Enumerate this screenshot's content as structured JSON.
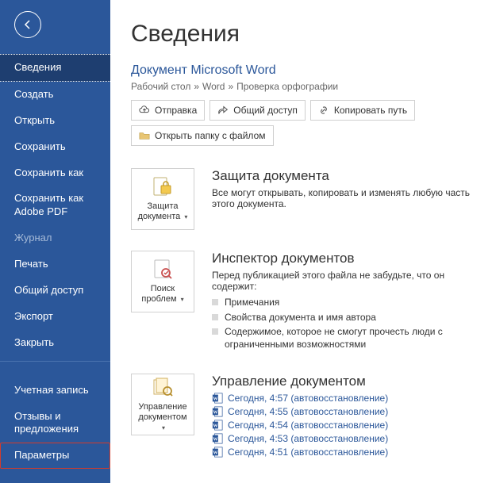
{
  "sidebar": {
    "items": [
      {
        "label": "Сведения",
        "active": true
      },
      {
        "label": "Создать"
      },
      {
        "label": "Открыть"
      },
      {
        "label": "Сохранить"
      },
      {
        "label": "Сохранить как"
      },
      {
        "label": "Сохранить как Adobe PDF"
      },
      {
        "label": "Журнал",
        "disabled": true
      },
      {
        "label": "Печать"
      },
      {
        "label": "Общий доступ"
      },
      {
        "label": "Экспорт"
      },
      {
        "label": "Закрыть"
      }
    ],
    "footer": [
      {
        "label": "Учетная запись"
      },
      {
        "label": "Отзывы и предложения"
      },
      {
        "label": "Параметры",
        "highlight": true
      }
    ]
  },
  "main": {
    "heading": "Сведения",
    "doc_title": "Документ Microsoft Word",
    "breadcrumb": [
      "Рабочий стол",
      "Word",
      "Проверка орфографии"
    ],
    "actions": [
      {
        "icon": "cloud-up",
        "label": "Отправка"
      },
      {
        "icon": "share-arrow",
        "label": "Общий доступ"
      },
      {
        "icon": "link",
        "label": "Копировать путь"
      },
      {
        "icon": "folder",
        "label": "Открыть папку с файлом"
      }
    ],
    "sections": [
      {
        "tile_icon": "lock-doc",
        "tile_label": "Защита документа",
        "title": "Защита документа",
        "desc": "Все могут открывать, копировать и изменять любую часть этого документа."
      },
      {
        "tile_icon": "inspect",
        "tile_label": "Поиск проблем",
        "title": "Инспектор документов",
        "desc": "Перед публикацией этого файла не забудьте, что он содержит:",
        "bullets": [
          "Примечания",
          "Свойства документа и имя автора",
          "Содержимое, которое не смогут прочесть люди с ограниченными возможностями"
        ]
      },
      {
        "tile_icon": "manage-doc",
        "tile_label": "Управление документом",
        "title": "Управление документом",
        "versions": [
          "Сегодня, 4:57 (автовосстановление)",
          "Сегодня, 4:55 (автовосстановление)",
          "Сегодня, 4:54 (автовосстановление)",
          "Сегодня, 4:53 (автовосстановление)",
          "Сегодня, 4:51 (автовосстановление)"
        ]
      }
    ]
  }
}
